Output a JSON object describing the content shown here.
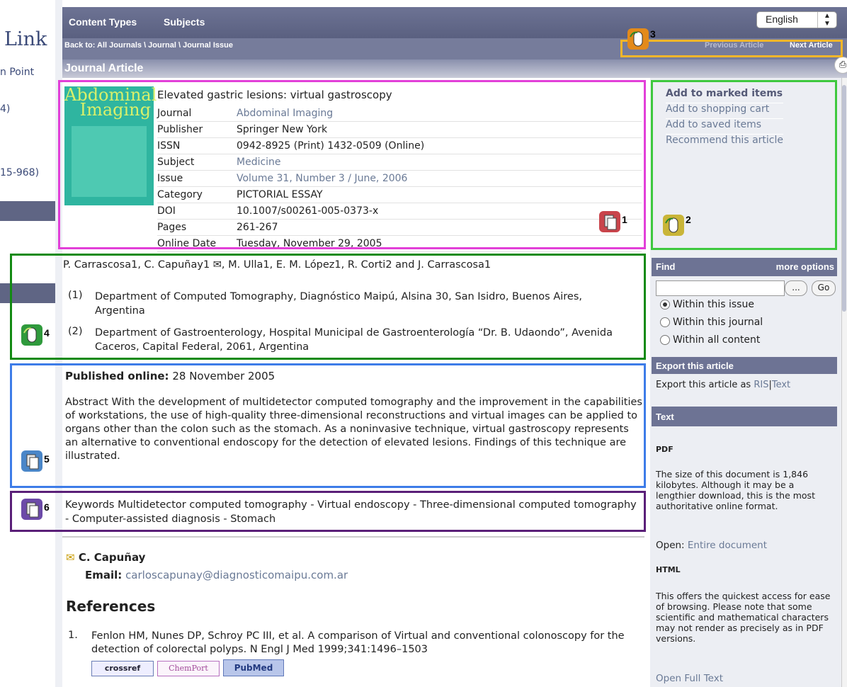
{
  "left": {
    "logo": "Link",
    "items": [
      "n Point",
      "4)",
      "15-968)"
    ]
  },
  "header": {
    "nav": [
      "Content Types",
      "Subjects"
    ],
    "language": "English",
    "breadcrumb": "Back to:  All Journals \\ Journal \\ Journal Issue",
    "prev": "Previous Article",
    "next": "Next Article",
    "page_title": "Journal Article"
  },
  "article": {
    "cover_title": "Abdominal Imaging",
    "title": "Elevated gastric lesions: virtual gastroscopy",
    "meta": [
      {
        "k": "Journal",
        "v": "Abdominal Imaging",
        "link": true
      },
      {
        "k": "Publisher",
        "v": "Springer New York",
        "link": false
      },
      {
        "k": "ISSN",
        "v": "0942-8925 (Print) 1432-0509 (Online)",
        "link": false
      },
      {
        "k": "Subject",
        "v": "Medicine",
        "link": true
      },
      {
        "k": "Issue",
        "v": "Volume 31, Number 3 / June, 2006",
        "link": true
      },
      {
        "k": "Category",
        "v": "PICTORIAL ESSAY",
        "link": false
      },
      {
        "k": "DOI",
        "v": "10.1007/s00261-005-0373-x",
        "link": false
      },
      {
        "k": "Pages",
        "v": "261-267",
        "link": false
      },
      {
        "k": "Online Date",
        "v": "Tuesday, November 29, 2005",
        "link": false
      }
    ],
    "authors": "P. Carrascosa1, C. Capuñay1 ✉, M. Ulla1, E. M. López1, R. Corti2 and J. Carrascosa1",
    "affil1_num": "(1)",
    "affil1": "Department of Computed Tomography, Diagnóstico Maipú, Alsina 30, San Isidro, Buenos Aires, Argentina",
    "affil2_num": "(2)",
    "affil2": "Department of Gastroenterology, Hospital Municipal de Gastroenterología “Dr. B. Udaondo”, Avenida Caceros, Capital Federal, 2061, Argentina",
    "published_label": "Published online:",
    "published_date": "28 November 2005",
    "abstract": "Abstract  With the development of multidetector computed tomography and the improvement in the capabilities of workstations, the use of high-quality three-dimensional reconstructions and virtual images can be applied to organs other than the colon such as the stomach. As a noninvasive technique, virtual gastroscopy represents an alternative to conventional endoscopy for the detection of elevated lesions. Findings of this technique are illustrated.",
    "keywords": "Keywords  Multidetector computed tomography - Virtual endoscopy - Three-dimensional computed tomography - Computer-assisted diagnosis - Stomach",
    "contact_name": "C. Capuñay",
    "email_label": "Email:",
    "email": "carloscapunay@diagnosticomaipu.com.ar",
    "references_heading": "References",
    "ref1_num": "1.",
    "ref1": "Fenlon HM, Nunes DP, Schroy PC III, et al. A comparison of Virtual and conventional colonoscopy for the detection of colorectal polyps. N Engl J Med 1999;341:1496–1503",
    "ref_buttons": [
      "crossref",
      "ChemPort",
      "PubMed"
    ]
  },
  "sidebar": {
    "actions": [
      "Add to marked items",
      "Add to shopping cart",
      "Add to saved items",
      "Recommend this article"
    ],
    "find_label": "Find",
    "more_options": "more options",
    "find_button": "...",
    "go_button": "Go",
    "scopes": [
      "Within this issue",
      "Within this journal",
      "Within all content"
    ],
    "export_heading": "Export this article",
    "export_text": "Export this article as",
    "export_ris": "RIS",
    "export_sep": "|",
    "export_text_link": "Text",
    "text_heading": "Text",
    "pdf_label": "PDF",
    "pdf_desc": "The size of this document is 1,846 kilobytes. Although it may be a lengthier download, this is the most authoritative online format.",
    "open_label": "Open:",
    "open_link": "Entire document",
    "html_label": "HTML",
    "html_desc": "This offers the quickest access for ease of browsing. Please note that some scientific and mathematical characters may not render as precisely as in PDF versions.",
    "open_full": "Open Full Text"
  },
  "annotations": {
    "labels": [
      "1",
      "2",
      "3",
      "4",
      "5",
      "6"
    ],
    "colors": {
      "magenta": "#e23fd8",
      "green_light": "#3ec83e",
      "orange": "#f2b62a",
      "green_dark": "#138a13",
      "blue": "#3d7ce8",
      "purple": "#5a1f78"
    }
  }
}
